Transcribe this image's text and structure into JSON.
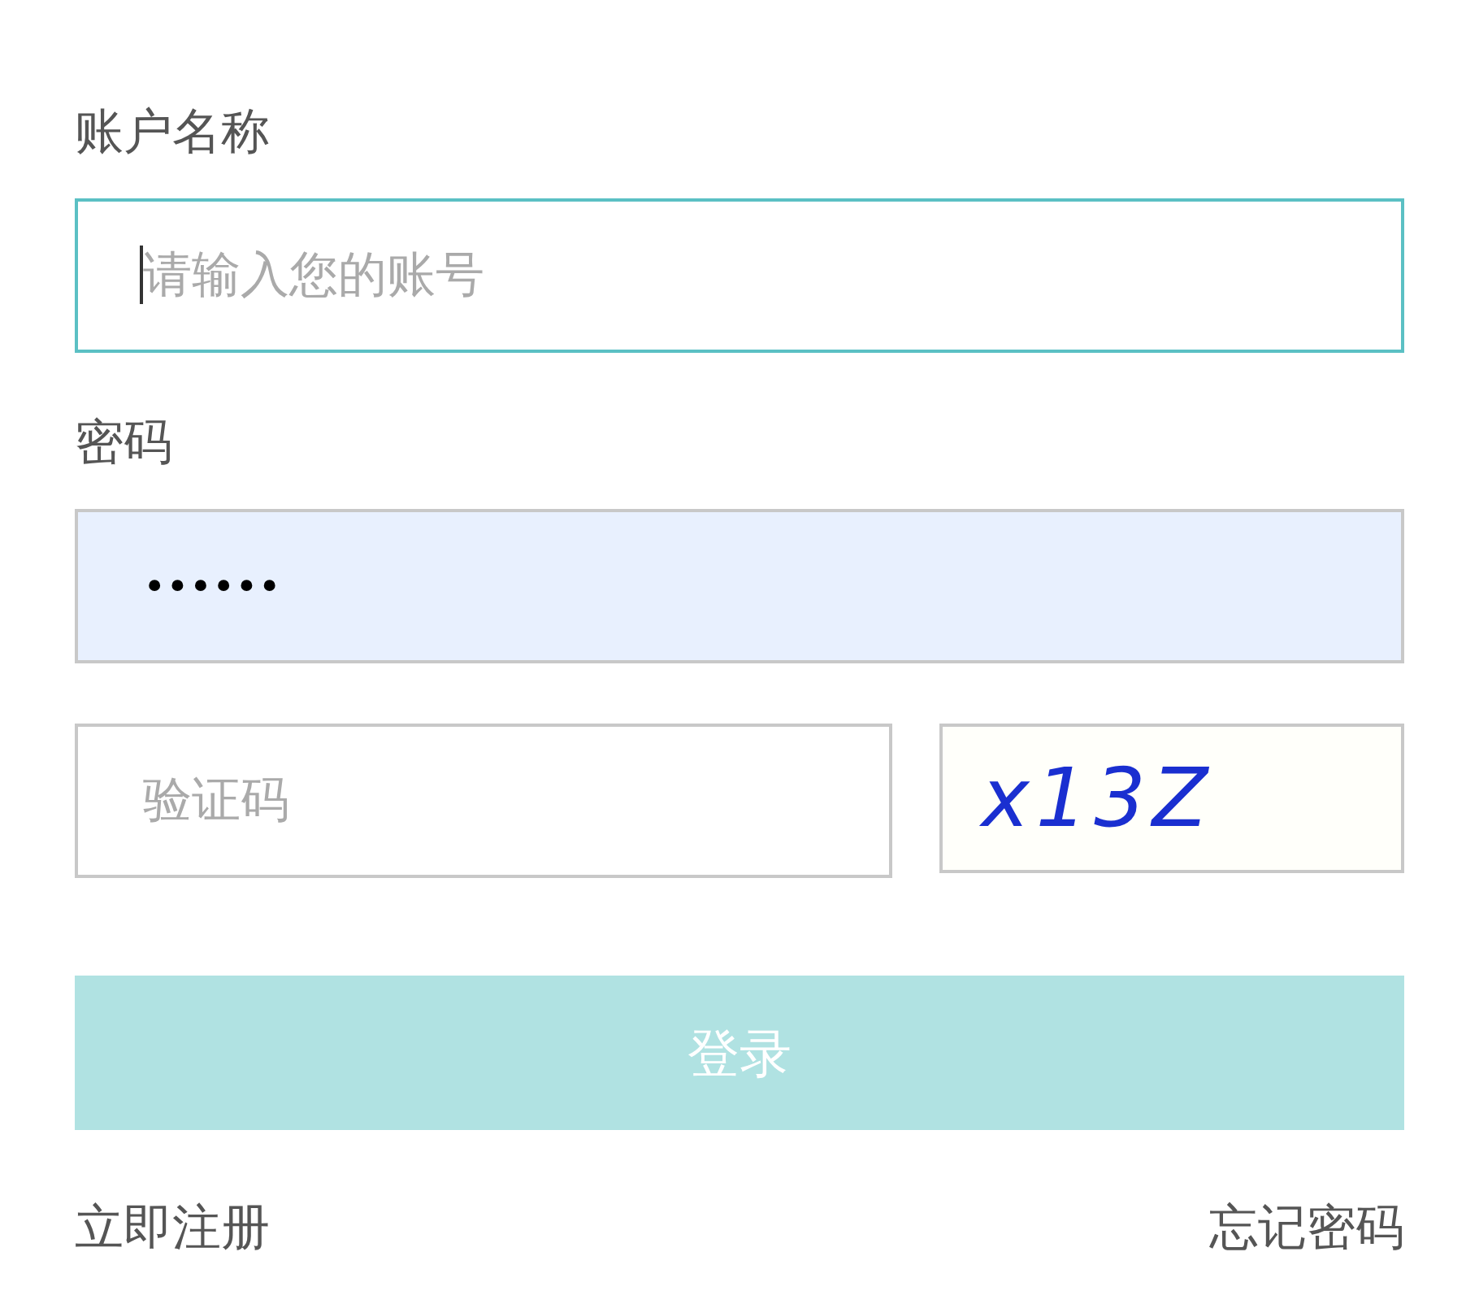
{
  "account": {
    "label": "账户名称",
    "placeholder": "请输入您的账号",
    "focused": true
  },
  "password": {
    "label": "密码",
    "value": "••••••",
    "autofilled": true
  },
  "captcha": {
    "placeholder": "验证码",
    "code": "x13Z"
  },
  "login_button": {
    "label": "登录",
    "disabled": true
  },
  "links": {
    "register": "立即注册",
    "forgot": "忘记密码"
  }
}
